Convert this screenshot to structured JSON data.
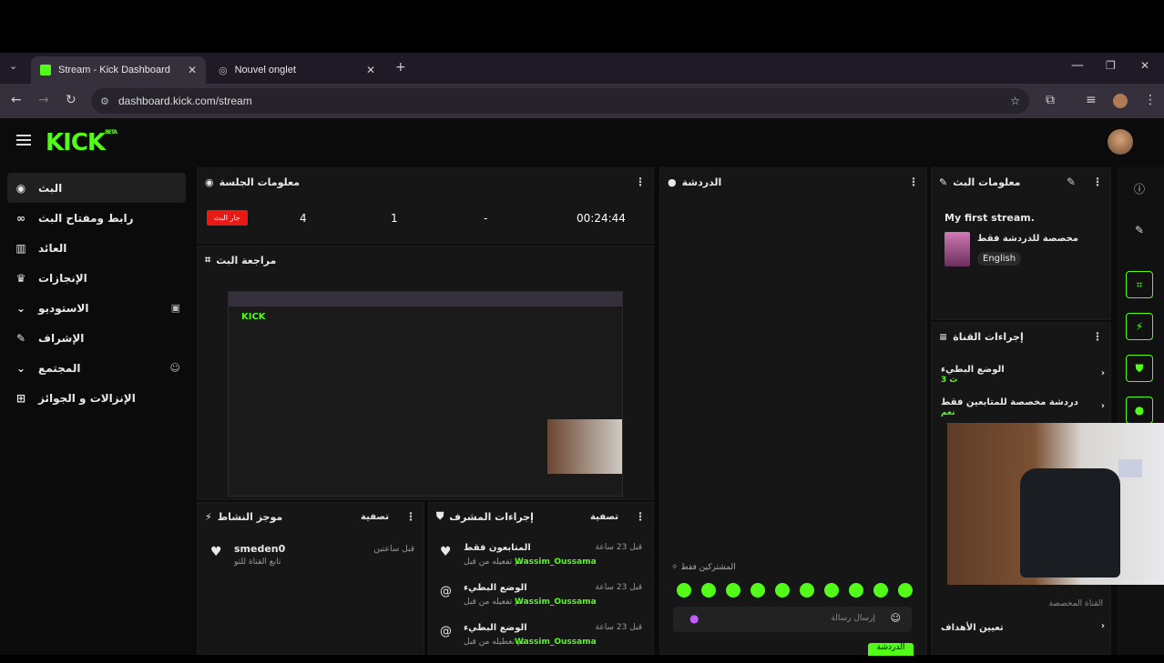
{
  "browser": {
    "tabs": [
      {
        "label": "Stream - Kick Dashboard",
        "active": true
      },
      {
        "label": "Nouvel onglet",
        "active": false
      }
    ],
    "url": "dashboard.kick.com/stream"
  },
  "header": {
    "logo": "KICK",
    "logo_tag": "BETA"
  },
  "sidebar": {
    "items": [
      {
        "label": "البث",
        "icon": "broadcast-icon",
        "glyph": "◉"
      },
      {
        "label": "رابط ومفتاح البث",
        "icon": "link-icon",
        "glyph": "∞"
      },
      {
        "label": "العائد",
        "icon": "bar-chart-icon",
        "glyph": "▥"
      },
      {
        "label": "الإنجازات",
        "icon": "trophy-icon",
        "glyph": "♛"
      },
      {
        "label": "الاستوديو",
        "icon": "chevron-down-icon",
        "glyph": "⌄"
      },
      {
        "label": "الإشراف",
        "icon": "wrench-icon",
        "glyph": "✎"
      },
      {
        "label": "المجتمع",
        "icon": "chevron-down-icon",
        "glyph": "⌄"
      },
      {
        "label": "الإنزالات و الجوائز",
        "icon": "gift-icon",
        "glyph": "⊞"
      }
    ]
  },
  "session": {
    "title": "معلومات الجلسة",
    "live_badge": "جار البث",
    "stats": [
      "4",
      "1",
      "-",
      "00:24:44"
    ]
  },
  "preview": {
    "title": "مراجعة البث"
  },
  "chat": {
    "title": "الدردشة",
    "subscribers_only": "المشتركين فقط",
    "input_placeholder": "إرسال رسالة",
    "send_label": "الدردشة"
  },
  "stream_info": {
    "title": "معلومات البث",
    "stream_title": "My first stream.",
    "category": "مخصصة للدردشة فقط",
    "language": "English"
  },
  "channel_actions": {
    "title": "إجراءات القناة",
    "items": [
      {
        "label": "الوضع البطيء",
        "sub": "3 ث"
      },
      {
        "label": "دردشة مخصصة للمتابعين فقط",
        "sub": "نعم"
      }
    ],
    "custom_channel": "القناة المخصصة",
    "goals": "تعيين الأهداف"
  },
  "activity": {
    "title": "موجز النشاط",
    "filter": "تصفية",
    "entries": [
      {
        "user": "smeden0",
        "desc": "تابع القناة للتو",
        "time": "قبل ساعتين"
      }
    ]
  },
  "mod_actions": {
    "title": "إجراءات المشرف",
    "filter": "تصفية",
    "entries": [
      {
        "label": "المتابعون فقط",
        "by": "تم تفعيله من قبل",
        "user": "Wassim_Oussama",
        "time": "قبل 23 ساعة"
      },
      {
        "label": "الوضع البطيء",
        "by": "تم تفعيله من قبل",
        "user": "Wassim_Oussama",
        "time": "قبل 23 ساعة"
      },
      {
        "label": "الوضع البطيء",
        "by": "تم تعطيله من قبل",
        "user": "Wassim_Oussama",
        "time": "قبل 23 ساعة"
      }
    ]
  },
  "colors": {
    "accent": "#53fc18",
    "live": "#e91916",
    "panel": "#161616"
  }
}
